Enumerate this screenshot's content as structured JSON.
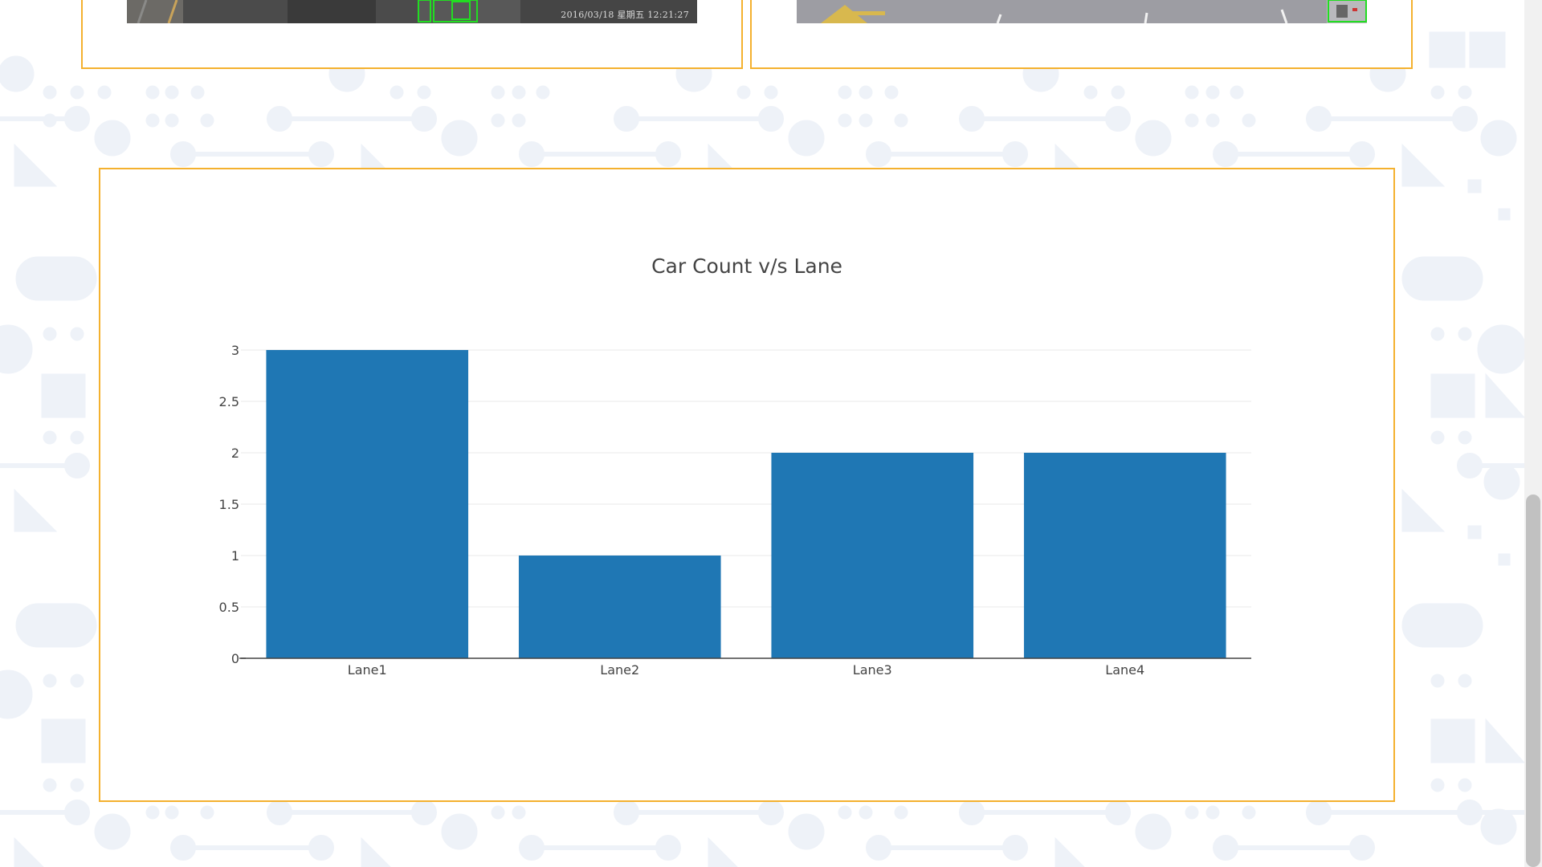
{
  "top_cards": {
    "left_video": {
      "timestamp": "2016/03/18 星期五 12:21:27"
    },
    "right_video": {}
  },
  "colors": {
    "card_border": "#f4b12f",
    "bar_fill": "#1f77b4",
    "detection_box": "#22dd22",
    "background_pattern": "#eef2f8"
  },
  "chart_data": {
    "type": "bar",
    "title": "Car Count v/s Lane",
    "categories": [
      "Lane1",
      "Lane2",
      "Lane3",
      "Lane4"
    ],
    "values": [
      3,
      1,
      2,
      2
    ],
    "xlabel": "",
    "ylabel": "",
    "ylim": [
      0,
      3
    ],
    "yticks": [
      0,
      0.5,
      1,
      1.5,
      2,
      2.5,
      3
    ],
    "ytick_labels": [
      "0",
      "0.5",
      "1",
      "1.5",
      "2",
      "2.5",
      "3"
    ],
    "grid": true,
    "legend": "none"
  }
}
